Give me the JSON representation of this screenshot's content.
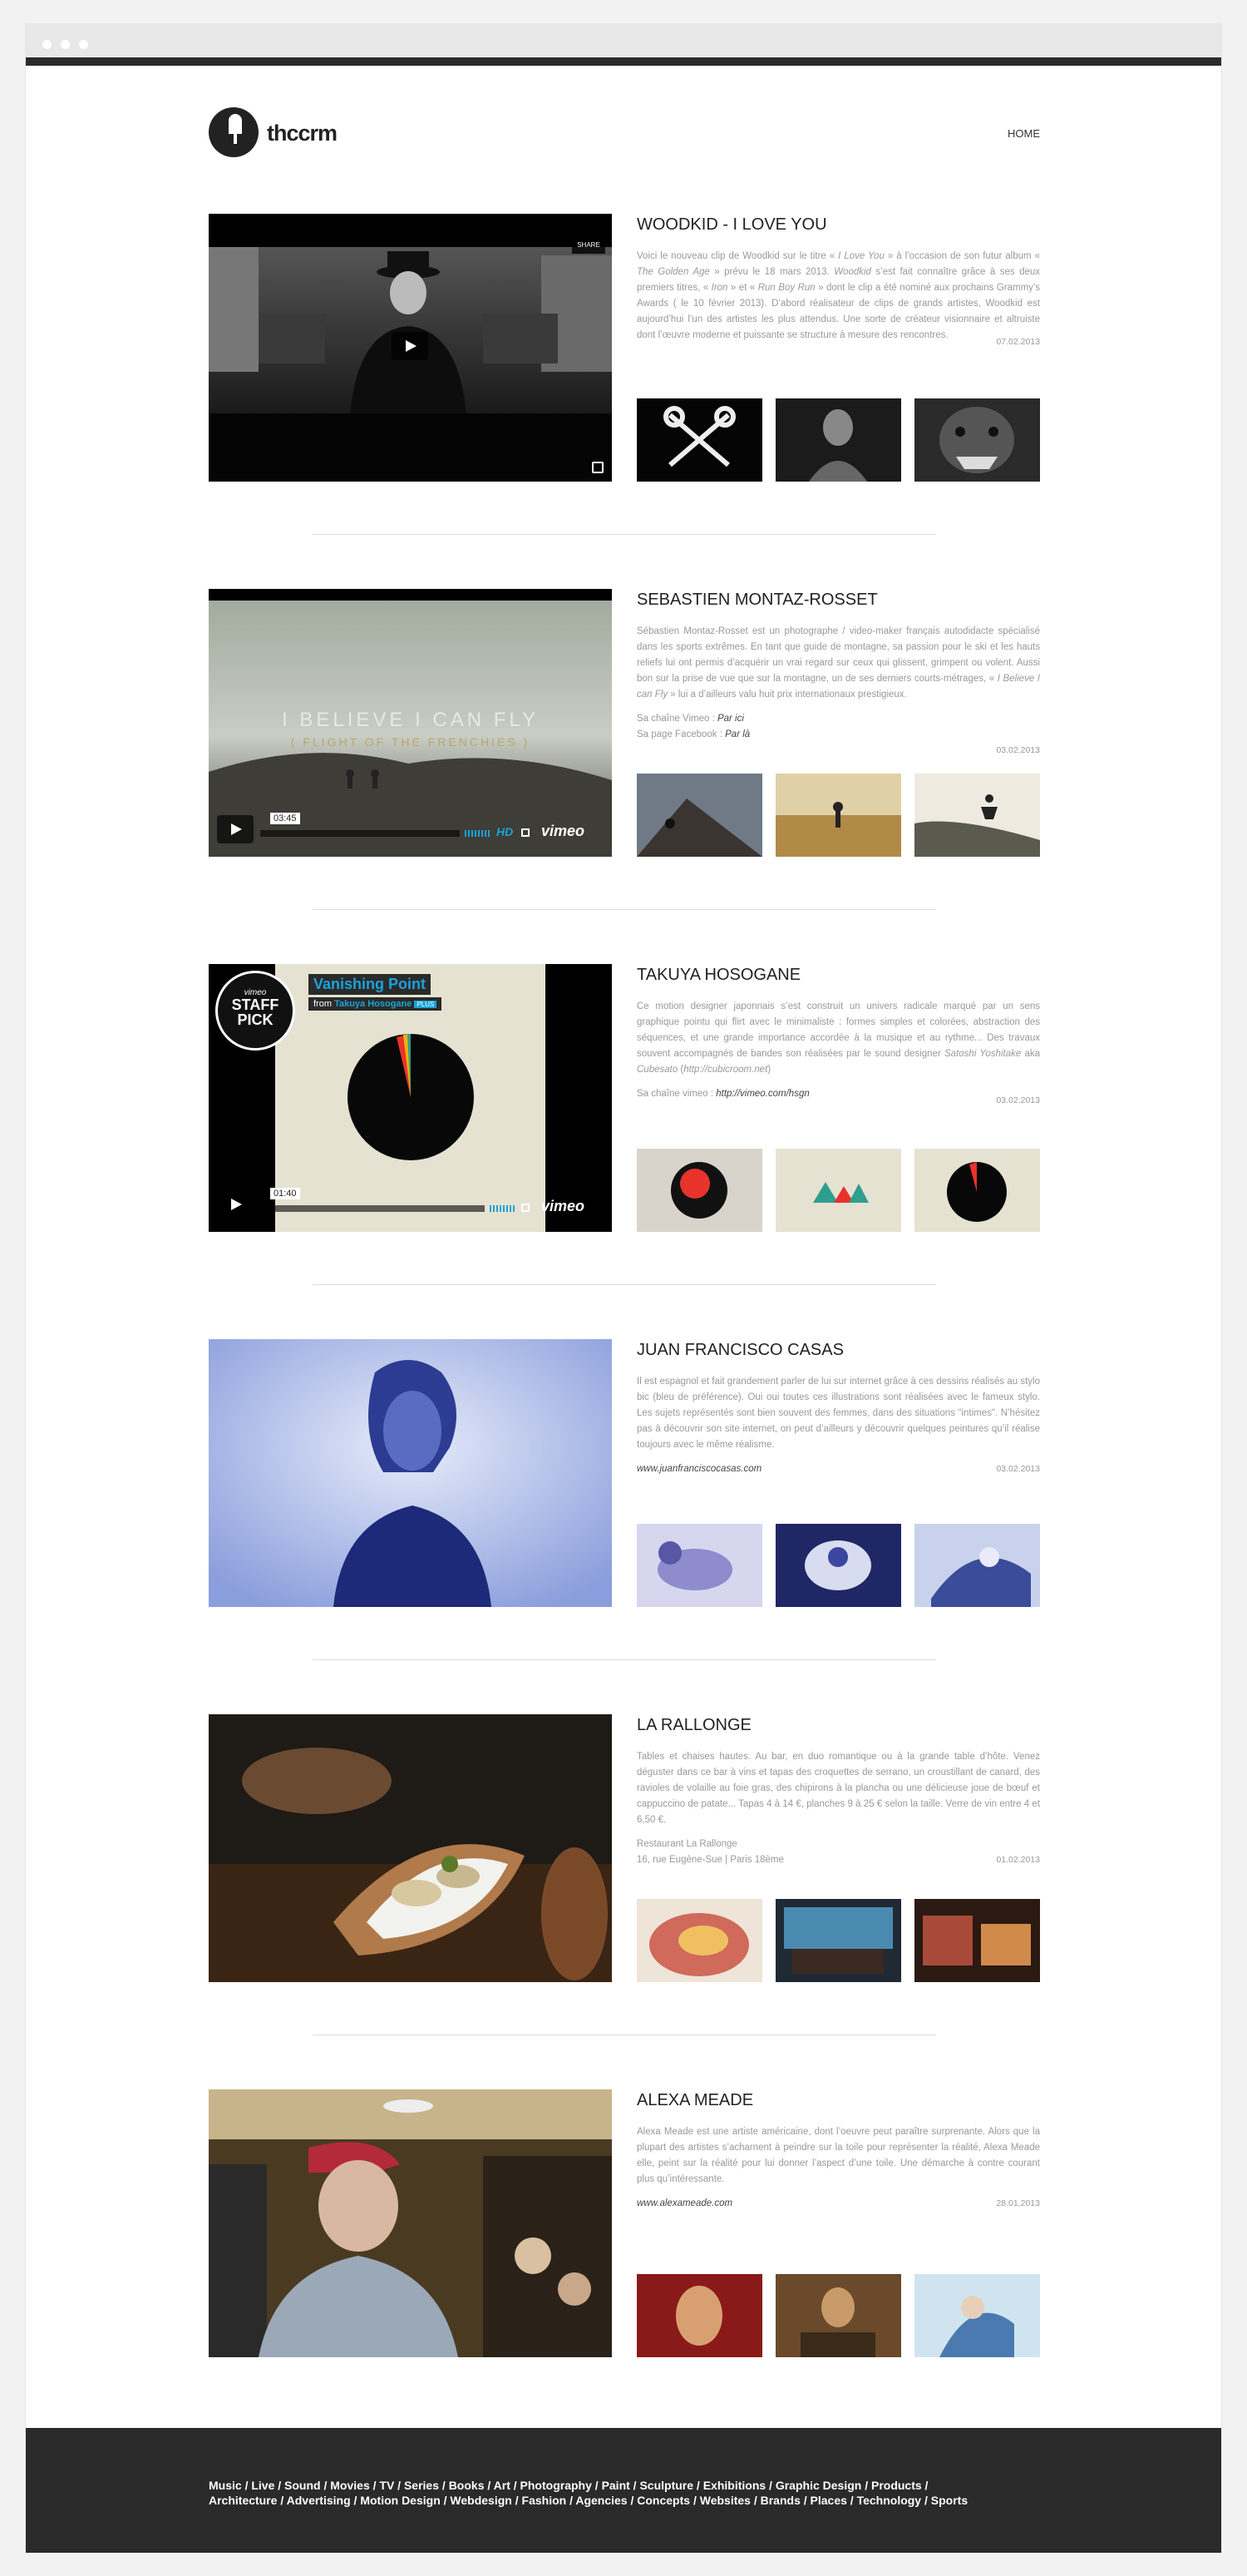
{
  "site": {
    "logo_text": "thccrm",
    "nav": {
      "home": "HOME"
    }
  },
  "posts": [
    {
      "title": "WOODKID - I LOVE YOU",
      "desc_html": "Voici le nouveau clip de Woodkid sur le titre « <i>I Love You</i> » à l’occasion de son futur album « <i>The Golden Age</i> » prévu le 18 mars 2013. <i>Woodkid</i> s’est fait connaître grâce à ses deux premiers titres, « <i>Iron</i> » et « <i>Run Boy Run</i> » dont le clip a été nominé aux prochains Grammy’s Awards ( le 10 février 2013). D’abord réalisateur de clips de grands artistes, Woodkid est aujourd’hui l’un des artistes les plus attendus. Une sorte de créateur visionnaire et altruiste dont l’œuvre moderne et puissante se structure à mesure des rencontres.",
      "meta": [],
      "date": "07.02.2013",
      "share_label": "SHARE"
    },
    {
      "title": "SEBASTIEN MONTAZ-ROSSET",
      "desc_html": "Sébastien Montaz-Rosset est un photographe / video-maker français autodidacte spécialisé dans les sports extrêmes. En tant que guide de montagne, sa passion pour le ski et les hauts reliefs lui ont permis d’acquérir un vrai regard sur ceux qui glissent, grimpent ou volent. Aussi bon sur la prise de vue que sur la montagne, un de ses derniers courts-métrages, « <i>I Believe I can Fly</i> » lui a d’ailleurs valu huit prix internationaux prestigieux.",
      "meta": [
        {
          "label": "Sa chaîne Vimeo : ",
          "link": "Par ici"
        },
        {
          "label": "Sa page Facebook : ",
          "link": "Par là"
        }
      ],
      "date": "03.02.2013",
      "video": {
        "title": "I BELIEVE I CAN FLY",
        "subtitle": "( FLIGHT OF THE FRENCHIES )",
        "time": "03:45",
        "hd": "HD",
        "brand": "vimeo"
      }
    },
    {
      "title": "TAKUYA HOSOGANE",
      "desc_html": "Ce motion designer japonnais s’est construit un univers radicale marqué par un sens graphique pointu qui flirt avec le minimaliste : formes simples et colorées, abstraction des séquences, et une grande importance accordée à la musique et au rythme... Des travaux souvent accompagnés de bandes son réalisées par le sound designer <i>Satoshi Yoshitake</i> aka <i>Cubesato</i> (<i>http://cubicroom.net</i>)",
      "meta": [
        {
          "label": "Sa chaîne vimeo : ",
          "link": "http://vimeo.com/hsgn"
        }
      ],
      "date": "03.02.2013",
      "video": {
        "title": "Vanishing Point",
        "from": "from",
        "author": "Takuya Hosogane",
        "plus": "PLUS",
        "badge_top": "vimeo",
        "badge_staff": "STAFF",
        "badge_pick": "PICK",
        "time": "01:40",
        "brand": "vimeo"
      }
    },
    {
      "title": "JUAN FRANCISCO CASAS",
      "desc_html": "Il est espagnol et fait grandement parler de lui sur internet grâce à ces dessins réalisés au stylo bic (bleu de préférence). Oui oui toutes ces illustrations sont réalisées avec le fameux stylo. Les sujets représentés sont bien souvent des femmes, dans des situations \"intimes\". N’hésitez pas à découvrir son site internet, on peut d’ailleurs y découvrir quelques peintures qu’il réalise toujours avec le même réalisme.",
      "meta": [
        {
          "label": "",
          "link": "www.juanfranciscocasas.com"
        }
      ],
      "date": "03.02.2013"
    },
    {
      "title": "LA RALLONGE",
      "desc_html": "Tables et chaises hautes. Au bar, en duo romantique ou à la grande table d’hôte. Venez déguster dans ce bar à vins et tapas des croquettes de serrano, un croustillant de canard, des ravioles de volaille au foie gras, des chipirons à la plancha ou une délicieuse joue de bœuf et cappuccino de patate... Tapas 4 à 14 €, planches 9 à 25 € selon la taille. Verre de vin entre 4 et 6,50 €.",
      "meta": [
        {
          "label": "Restaurant La Rallonge",
          "link": ""
        },
        {
          "label": "16, rue Eugène-Sue | Paris 18ème",
          "link": ""
        }
      ],
      "date": "01.02.2013"
    },
    {
      "title": "ALEXA MEADE",
      "desc_html": "Alexa Meade est une artiste américaine, dont l’oeuvre peut paraître surprenante. Alors que la plupart des artistes s’acharnent à peindre sur la toile pour représenter la réalité, Alexa Meade elle, peint sur la réalité pour lui donner l’aspect d’une toile. Une démarche à contre courant plus qu’intéressante.",
      "meta": [
        {
          "label": "",
          "link": "www.alexameade.com"
        }
      ],
      "date": "28.01.2013"
    }
  ],
  "footer": {
    "line1": [
      "Music",
      "Live",
      "Sound",
      "Movies",
      "TV",
      "Series",
      "Books",
      "Art",
      "Photography",
      "Paint",
      "Sculpture",
      "Exhibitions",
      "Graphic Design",
      "Products"
    ],
    "line2": [
      "Architecture",
      "Advertising",
      "Motion Design",
      "Webdesign",
      "Fashion",
      "Agencies",
      "Concepts",
      "Websites",
      "Brands",
      "Places",
      "Technology",
      "Sports"
    ]
  },
  "colors": {
    "accent_blue": "#1aa3d8",
    "footer_bg": "#2a2a2a"
  }
}
